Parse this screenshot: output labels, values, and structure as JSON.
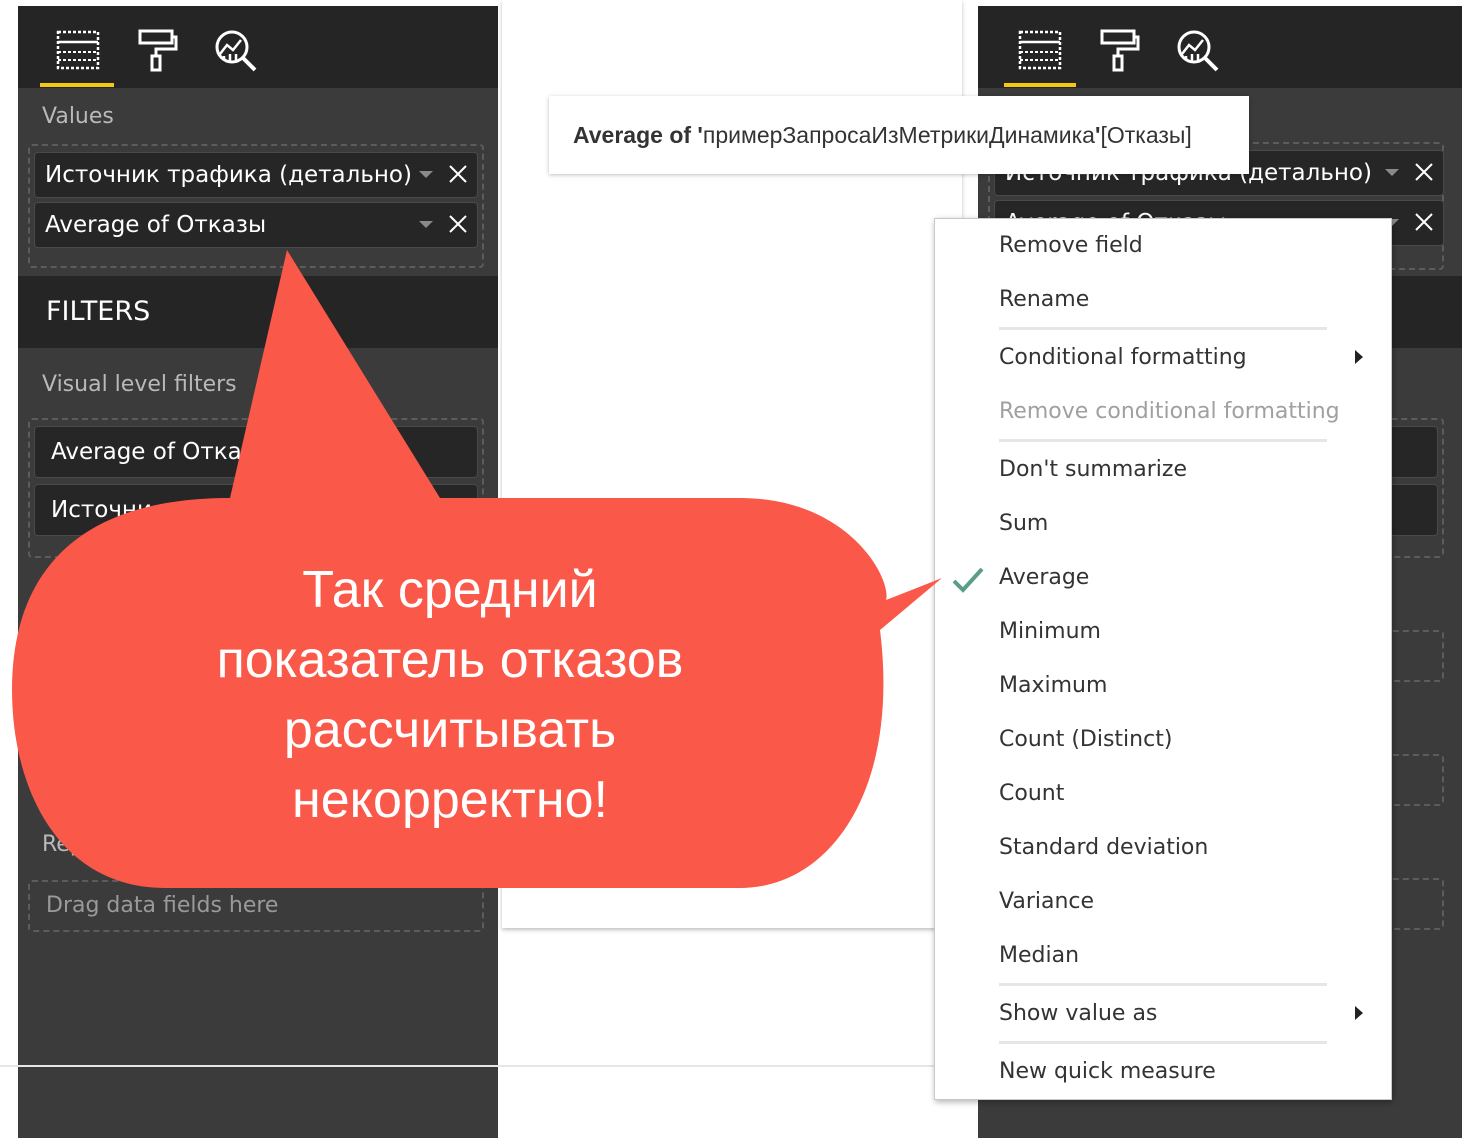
{
  "left_panel": {
    "values_label": "Values",
    "value_fields": [
      "Источник трафика (детально)",
      "Average of Отказы"
    ],
    "filters_header": "FILTERS",
    "visual_filters_label": "Visual level filters",
    "visual_filters": [
      "Average of Отказы  (All)",
      "Источни"
    ],
    "report_label": "Repo",
    "drag_placeholder": "Drag data fields here"
  },
  "tooltip": {
    "prefix": "Average of ",
    "quote_open": "'",
    "table": "примерЗапросаИзМетрикиДинамика",
    "quote_close": "'",
    "field": "[Отказы]"
  },
  "right_panel": {
    "value_fields": [
      "Источник трафика (детально)",
      "Average of Отказы"
    ]
  },
  "context_menu": {
    "items": [
      {
        "label": "Remove field"
      },
      {
        "label": "Rename"
      },
      {
        "label": "Conditional formatting",
        "submenu": true
      },
      {
        "label": "Remove conditional formatting",
        "disabled": true
      },
      {
        "label": "Don't summarize"
      },
      {
        "label": "Sum"
      },
      {
        "label": "Average",
        "checked": true
      },
      {
        "label": "Minimum"
      },
      {
        "label": "Maximum"
      },
      {
        "label": "Count (Distinct)"
      },
      {
        "label": "Count"
      },
      {
        "label": "Standard deviation"
      },
      {
        "label": "Variance"
      },
      {
        "label": "Median"
      },
      {
        "label": "Show value as",
        "submenu": true
      },
      {
        "label": "New quick measure"
      }
    ]
  },
  "callout": {
    "lines": [
      "Так средний",
      "показатель отказов",
      "рассчитывать",
      "некорректно!"
    ],
    "color": "#fa5848"
  },
  "colors": {
    "panel": "#3b3b3b",
    "panel_header": "#252525",
    "accent": "#f2c811",
    "check": "#5a9e86"
  },
  "icons": [
    "fields-icon",
    "format-paint-roller-icon",
    "analytics-magnifier-icon",
    "close-icon",
    "dropdown-caret-icon",
    "checkmark-icon",
    "submenu-arrow-icon"
  ]
}
